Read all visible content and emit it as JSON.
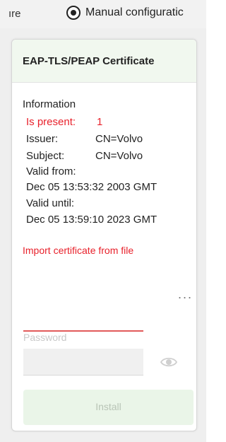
{
  "top": {
    "left_text": "ıre",
    "radio_label": "Manual configuratic"
  },
  "panel": {
    "title": "EAP-TLS/PEAP Certificate",
    "info_heading": "Information",
    "is_present_label": "Is present:",
    "is_present_value": "1",
    "issuer_label": "Issuer:",
    "issuer_value": "CN=Volvo",
    "subject_label": "Subject:",
    "subject_value": "CN=Volvo",
    "valid_from_label": "Valid from:",
    "valid_from_value": "Dec 05 13:53:32 2003 GMT",
    "valid_until_label": "Valid until:",
    "valid_until_value": "Dec 05 13:59:10 2023 GMT",
    "import_label": "Import certificate from file",
    "browse_label": "...",
    "password_label": "Password",
    "install_label": "Install"
  },
  "colors": {
    "accent_red": "#e8212b",
    "header_green": "#f1f8ef",
    "install_bg": "#eaf5e8"
  },
  "icons": {
    "radio": "radio-selected-icon",
    "eye": "eye-icon"
  }
}
